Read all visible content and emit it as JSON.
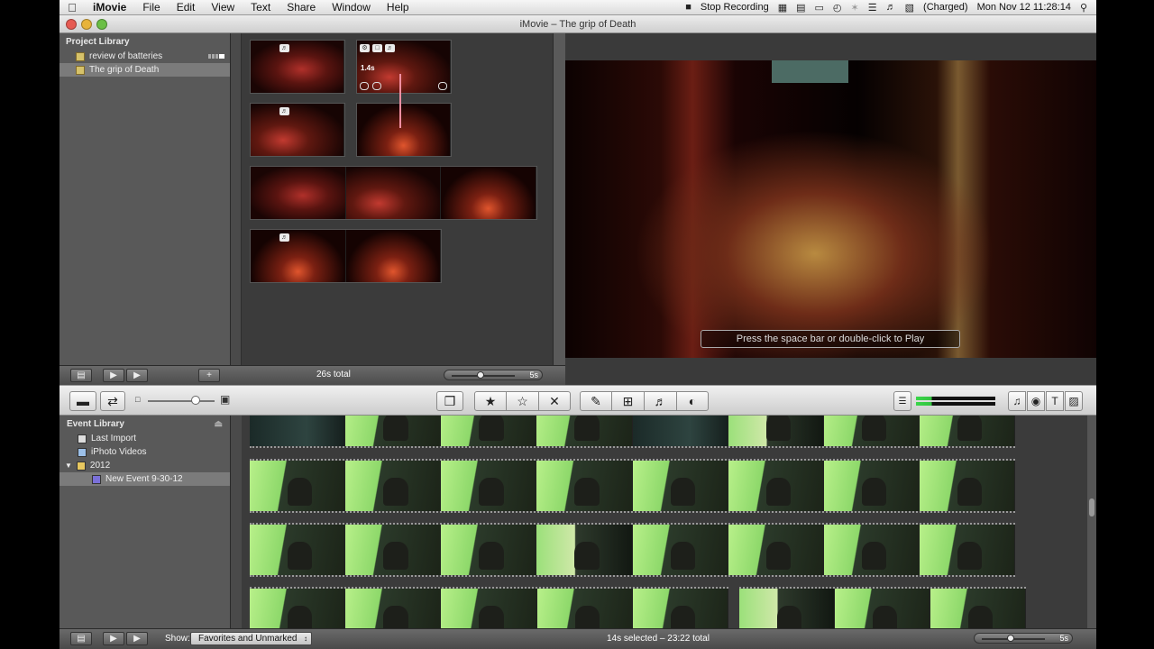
{
  "menubar": {
    "app": "iMovie",
    "menus": [
      "File",
      "Edit",
      "View",
      "Text",
      "Share",
      "Window",
      "Help"
    ],
    "recording": "Stop Recording",
    "battery": "(Charged)",
    "clock": "Mon Nov 12  11:28:14"
  },
  "window": {
    "title": "iMovie – The grip of Death"
  },
  "project_library": {
    "header": "Project Library",
    "items": [
      {
        "label": "review of batteries"
      },
      {
        "label": "The grip of Death"
      }
    ]
  },
  "project": {
    "clip_duration": "1.4s",
    "total": "26s total",
    "zoom_label": "5s"
  },
  "viewer": {
    "hint": "Press the space bar or double-click to Play"
  },
  "event_library": {
    "header": "Event Library",
    "items": [
      {
        "label": "Last Import"
      },
      {
        "label": "iPhoto Videos"
      },
      {
        "label": "2012"
      },
      {
        "label": "New Event 9-30-12"
      }
    ]
  },
  "bottom": {
    "show_label": "Show:",
    "show_value": "Favorites and Unmarked",
    "status": "14s selected – 23:22 total",
    "zoom_label": "5s"
  },
  "icons": {
    "apple": "",
    "star": "★",
    "star_outline": "☆",
    "reject": "✕",
    "voiceover": "♫",
    "camera": "◉",
    "title": "T",
    "transition": "▨"
  }
}
